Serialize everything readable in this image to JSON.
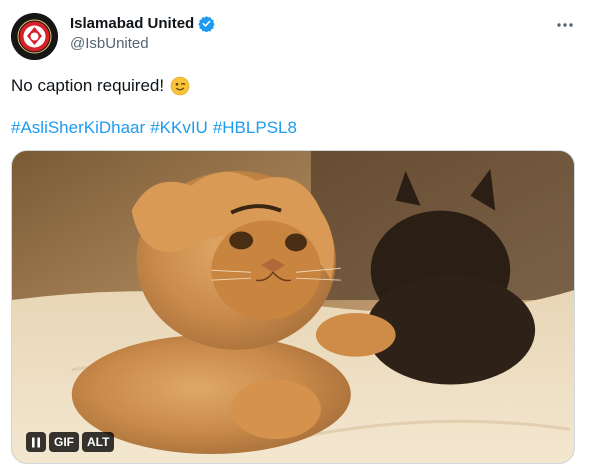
{
  "author": {
    "display_name": "Islamabad United",
    "handle": "@IsbUnited",
    "avatar_icon": "islamabad-united-logo",
    "verified": true
  },
  "tweet": {
    "text": "No caption required!",
    "emoji": "winking-face",
    "hashtags": [
      "#AsliSherKiDhaar",
      "#KKvIU",
      "#HBLPSL8"
    ]
  },
  "media": {
    "type": "gif",
    "controls": {
      "pause_icon": "pause-icon",
      "gif_label": "GIF",
      "alt_label": "ALT"
    }
  },
  "colors": {
    "link": "#1d9bf0",
    "verified": "#1d9bf0",
    "secondary_text": "#536471"
  }
}
